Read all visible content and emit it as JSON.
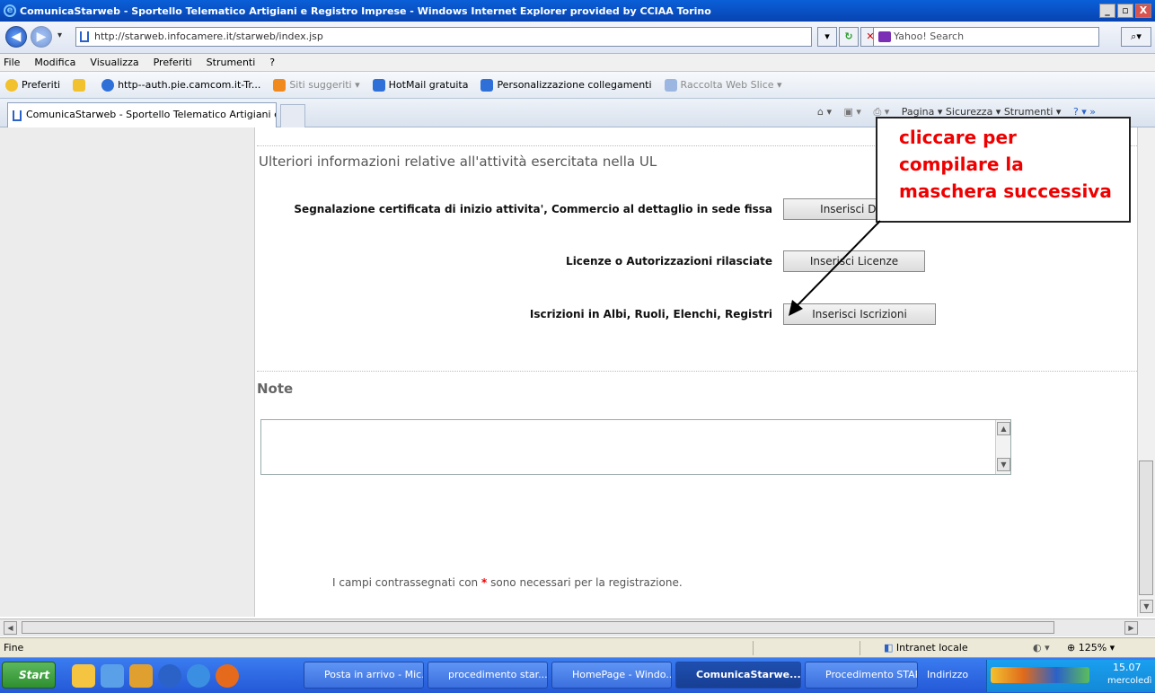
{
  "window": {
    "title": "ComunicaStarweb - Sportello Telematico Artigiani e Registro Imprese - Windows Internet Explorer provided by CCIAA Torino",
    "buttons": [
      "_",
      "▫",
      "X"
    ]
  },
  "address": {
    "url": "http://starweb.infocamere.it/starweb/index.jsp",
    "search_placeholder": "Yahoo! Search"
  },
  "menu": [
    "File",
    "Modifica",
    "Visualizza",
    "Preferiti",
    "Strumenti",
    "?"
  ],
  "favorites": {
    "label": "Preferiti",
    "items": [
      {
        "label": "http--auth.pie.camcom.it-Tr...",
        "color": "#2f6fd8",
        "muted": false
      },
      {
        "label": "Siti suggeriti ▾",
        "color": "#f08a1e",
        "muted": true
      },
      {
        "label": "HotMail gratuita",
        "color": "#2f6fd8",
        "muted": false
      },
      {
        "label": "Personalizzazione collegamenti",
        "color": "#2f6fd8",
        "muted": false
      },
      {
        "label": "Raccolta Web Slice ▾",
        "color": "#2f6fd8",
        "muted": true
      }
    ]
  },
  "tabs": {
    "active": "ComunicaStarweb - Sportello Telematico Artigiani e Re...",
    "toolbar_right": "Pagina ▾   Sicurezza ▾   Strumenti ▾"
  },
  "page": {
    "section_title": "Ulteriori informazioni relative all'attività esercitata nella UL",
    "rows": [
      {
        "label": "Segnalazione certificata di inizio attivita', Commercio al dettaglio in sede fissa",
        "button": "Inserisci Dati"
      },
      {
        "label": "Licenze o Autorizzazioni rilasciate",
        "button": "Inserisci Licenze"
      },
      {
        "label": "Iscrizioni in Albi, Ruoli, Elenchi, Registri",
        "button": "Inserisci Iscrizioni"
      }
    ],
    "note_title": "Note",
    "note_value": "",
    "footer_before": "I campi contrassegnati con",
    "footer_asterisk": "*",
    "footer_after": "sono necessari per la registrazione."
  },
  "annotation": {
    "lines": [
      "cliccare per",
      "compilare la",
      "maschera successiva"
    ],
    "color": "#e00000"
  },
  "status": {
    "left": "Fine",
    "zone": "Intranet locale",
    "zoom": "125%"
  },
  "taskbar": {
    "start": "Start",
    "tasks": [
      {
        "label": "Posta in arrivo - Mic...",
        "active": false
      },
      {
        "label": "procedimento star...",
        "active": false
      },
      {
        "label": "HomePage - Windo...",
        "active": false
      },
      {
        "label": "ComunicaStarwe...",
        "active": true
      },
      {
        "label": "Procedimento STAR...",
        "active": false
      }
    ],
    "address_label": "Indirizzo",
    "time": "15.07",
    "day": "mercoledì"
  }
}
